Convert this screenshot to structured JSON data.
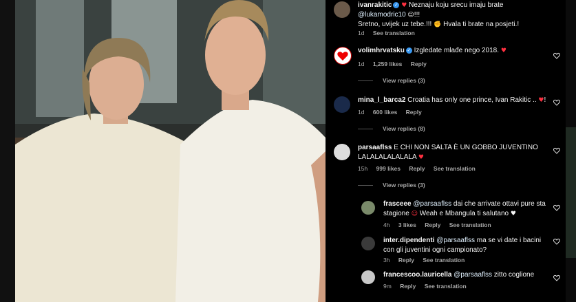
{
  "comments": [
    {
      "user": "ivanrakitic",
      "text": "Neznaju koju srecu imaju brate",
      "mention": "@lukamodric10",
      "text2": "!!!",
      "text3": "Sretno, uvijek uz tebe.!!!",
      "text4": "Hvala ti brate na posjeti.!",
      "time": "1d",
      "see_translation": "See translation"
    },
    {
      "user": "volimhrvatsku",
      "text": "Izgledate mlađe nego 2018.",
      "time": "1d",
      "likes": "1,259 likes",
      "reply": "Reply",
      "view_replies": "View replies (3)"
    },
    {
      "user": "mina_l_barca2",
      "text": "Croatia has only one prince, Ivan Rakitic ..",
      "text2": "!",
      "time": "1d",
      "likes": "600 likes",
      "reply": "Reply",
      "view_replies": "View replies (8)"
    },
    {
      "user": "parsaaflss",
      "text": "E CHI NON SALTA È UN GOBBO JUVENTINO",
      "text2": "LALALALALALALA",
      "time": "15h",
      "likes": "999 likes",
      "reply": "Reply",
      "see_translation": "See translation",
      "view_replies": "View replies (3)"
    }
  ],
  "replies": [
    {
      "user": "frasceee",
      "mention": "@parsaaflss",
      "text": "dai che arrivate ottavi pure sta",
      "text2": "stagione",
      "text3": "Weah e Mbangula ti salutano",
      "time": "4h",
      "likes": "3 likes",
      "reply": "Reply",
      "see_translation": "See translation"
    },
    {
      "user": "inter.dipendenti",
      "mention": "@parsaaflss",
      "text": "ma se vi date i bacini",
      "text2": "con gli juventini ogni campionato?",
      "time": "3h",
      "reply": "Reply",
      "see_translation": "See translation"
    },
    {
      "user": "francescoo.lauricella",
      "mention": "@parsaaflss",
      "text": "zitto coglione",
      "time": "9m",
      "reply": "Reply",
      "see_translation": "See translation"
    }
  ],
  "icons": {
    "like": "heart-outline-icon",
    "verified": "verified-badge-icon"
  },
  "colors": {
    "panel_bg": "#000000",
    "text": "#f5f5f5",
    "muted": "#a8a8a8",
    "verified": "#3897f0",
    "heart_red": "#ff3040"
  }
}
